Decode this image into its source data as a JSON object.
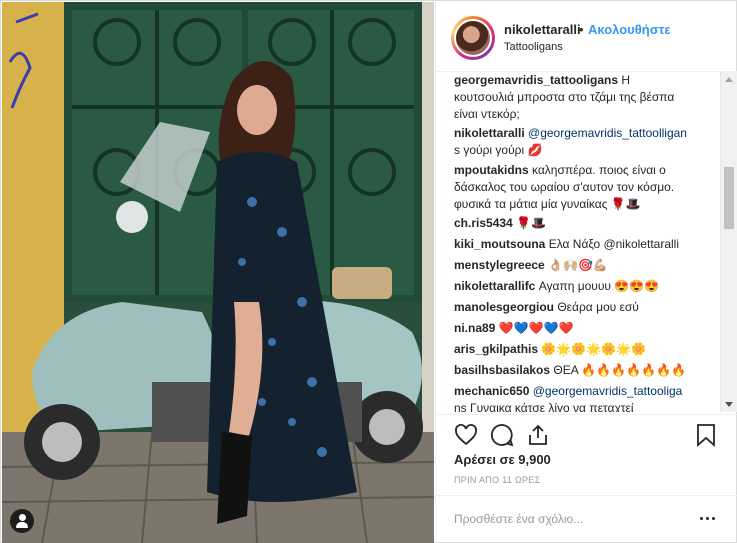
{
  "post": {
    "username": "nikolettaralli",
    "separator": "•",
    "follow_label": "Ακολουθήστε",
    "location": "Tattooligans"
  },
  "comments": [
    {
      "author": "georgemavridis_tattooligans",
      "text_lines": [
        "georgemavridis_tattooligans Η",
        "κουτσουλιά μπροστα στο τζάμι της βέσπα",
        "είναι ντεκόρ;"
      ]
    },
    {
      "author": "nikolettaralli",
      "mention": "@georgemavridis_tattoolligan",
      "text_lines": [
        "nikolettaralli @georgemavridis_tattoolligan",
        "s γούρι γούρι 💋"
      ]
    },
    {
      "author": "mpoutakidns",
      "text_lines": [
        "mpoutakidns καλησπέρα. ποιος είναι ο",
        "δάσκαλος του ωραίου σ'αυτον τον κόσμο.",
        "φυσικά τα μάτια μία γυναίκας 🌹🎩"
      ]
    },
    {
      "author": "ch.ris5434",
      "text_lines": [
        "ch.ris5434 🌹🎩"
      ]
    },
    {
      "author": "kiki_moutsouna",
      "text_lines": [
        "kiki_moutsouna Ελα Νάξο @nikolettaralli"
      ]
    },
    {
      "author": "menstylegreece",
      "text_lines": [
        "menstylegreece 👌🏼🙌🏼🎯💪🏼"
      ]
    },
    {
      "author": "nikolettarallifc",
      "text_lines": [
        "nikolettarallifc Αγαπη μουυυ 😍😍😍"
      ]
    },
    {
      "author": "manolesgeorgiou",
      "text_lines": [
        "manolesgeorgiou Θεάρα μου εσύ"
      ]
    },
    {
      "author": "ni.na89",
      "text_lines": [
        "ni.na89 ❤️💙❤️💙❤️"
      ]
    },
    {
      "author": "aris_gkilpathis",
      "text_lines": [
        "aris_gkilpathis 🌼🌟🌼🌟🌼🌟🌼"
      ]
    },
    {
      "author": "basilhsbasilakos",
      "text_lines": [
        "basilhsbasilakos ΘΕΑ 🔥🔥🔥🔥🔥🔥🔥"
      ]
    },
    {
      "author": "mechanic650",
      "text_lines": [
        "mechanic650 @georgemavridis_tattooliga",
        "ns Γυναικα κάτσε λίγο να πεταχτεί"
      ]
    }
  ],
  "actions": {
    "likes": "Αρέσει σε 9,900",
    "time": "ΠΡΙΝ ΑΠΟ 11 ΩΡΕΣ",
    "comment_placeholder": "Προσθέστε ένα σχόλιο...",
    "icons": [
      "heart-icon",
      "comment-icon",
      "share-icon",
      "bookmark-icon",
      "more-icon"
    ]
  },
  "colors": {
    "link": "#3897f0",
    "mention": "#003569",
    "text": "#262626",
    "muted": "#999999",
    "border": "#efefef"
  }
}
